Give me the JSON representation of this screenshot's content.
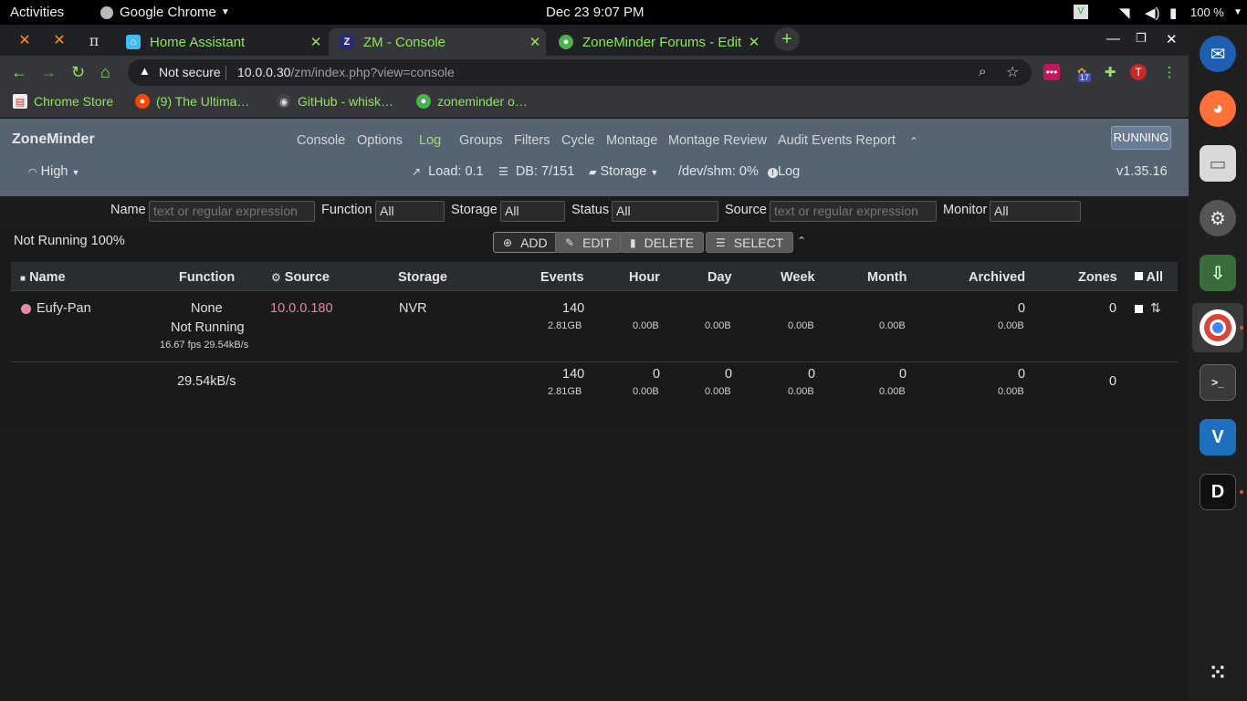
{
  "os": {
    "activities": "Activities",
    "app_name": "Google Chrome",
    "datetime": "Dec 23  9:07 PM",
    "battery": "100 %"
  },
  "browser": {
    "tabs": [
      {
        "label": "Home Assistant",
        "active": false
      },
      {
        "label": "ZM - Console",
        "active": true
      },
      {
        "label": "ZoneMinder Forums - Edit",
        "active": false
      }
    ],
    "security": "Not secure",
    "url_host": "10.0.0.30",
    "url_path": "/zm/index.php?view=console",
    "bookmarks": [
      "Chrome Store",
      "(9) The Ultima…",
      "GitHub - whisk…",
      "zoneminder o…"
    ],
    "profile_initial": "T",
    "ext_badge": "17"
  },
  "zm": {
    "logo": "ZoneMinder",
    "menu": [
      "Console",
      "Options",
      "Log",
      "Groups",
      "Filters",
      "Cycle",
      "Montage",
      "Montage Review",
      "Audit Events Report"
    ],
    "active_menu": "Log",
    "state": "RUNNING",
    "bandwidth": "High",
    "load": "Load: 0.1",
    "db": "DB: 7/151",
    "storage": "Storage",
    "shm": "/dev/shm: 0%",
    "log": "Log",
    "version": "v1.35.16",
    "filters": {
      "name_label": "Name",
      "name_placeholder": "text or regular expression",
      "function_label": "Function",
      "function_value": "All",
      "storage_label": "Storage",
      "storage_value": "All",
      "status_label": "Status",
      "status_value": "All",
      "source_label": "Source",
      "source_placeholder": "text or regular expression",
      "monitor_label": "Monitor",
      "monitor_value": "All"
    },
    "status_text": "Not Running 100%",
    "buttons": {
      "add": "ADD",
      "edit": "EDIT",
      "delete": "DELETE",
      "select": "SELECT"
    },
    "columns": [
      "Name",
      "Function",
      "Source",
      "Storage",
      "Events",
      "Hour",
      "Day",
      "Week",
      "Month",
      "Archived",
      "Zones",
      "All"
    ],
    "monitor": {
      "name": "Eufy-Pan",
      "function": "None",
      "function_status": "Not Running",
      "fps": "16.67 fps 29.54kB/s",
      "source": "10.0.0.180",
      "storage": "NVR",
      "events": "140",
      "events_size": "2.81GB",
      "hour_size": "0.00B",
      "day_size": "0.00B",
      "week_size": "0.00B",
      "month_size": "0.00B",
      "archived": "0",
      "archived_size": "0.00B",
      "zones": "0"
    },
    "totals": {
      "bandwidth": "29.54kB/s",
      "events": "140",
      "events_size": "2.81GB",
      "hour": "0",
      "hour_size": "0.00B",
      "day": "0",
      "day_size": "0.00B",
      "week": "0",
      "week_size": "0.00B",
      "month": "0",
      "month_size": "0.00B",
      "archived": "0",
      "archived_size": "0.00B",
      "zones": "0"
    }
  },
  "colors": {
    "accent_green": "#8ee65a",
    "zm_header": "#566370",
    "source_link": "#e08aa6",
    "status_dot": "#e88aa6"
  }
}
